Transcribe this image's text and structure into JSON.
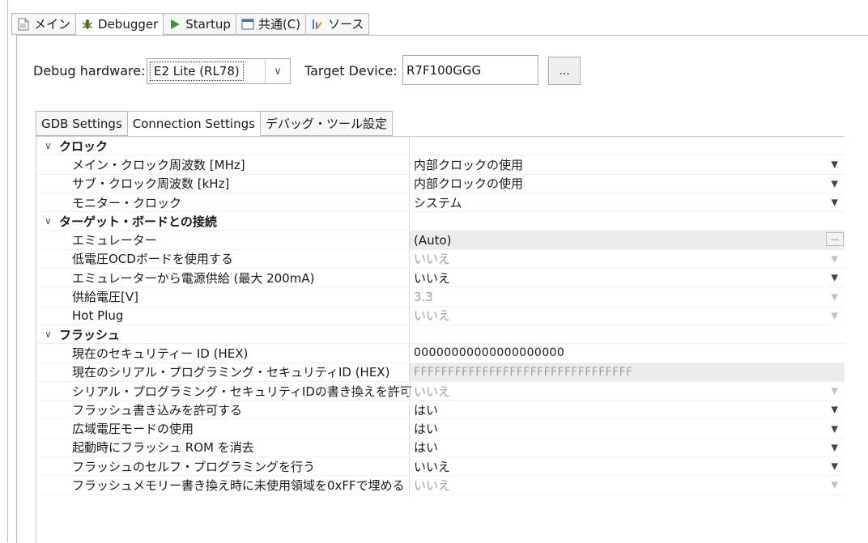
{
  "tabs": [
    {
      "label": "メイン",
      "icon": "document-icon"
    },
    {
      "label": "Debugger",
      "icon": "debugger-bug-icon"
    },
    {
      "label": "Startup",
      "icon": "play-icon"
    },
    {
      "label": "共通(C)",
      "icon": "common-window-icon"
    },
    {
      "label": "ソース",
      "icon": "source-lookup-icon"
    }
  ],
  "debug_hardware": {
    "label": "Debug hardware:",
    "value": "E2 Lite (RL78)"
  },
  "target_device": {
    "label": "Target Device:",
    "value": "R7F100GGG",
    "browse_label": "..."
  },
  "subtabs": [
    "GDB Settings",
    "Connection Settings",
    "デバッグ・ツール設定"
  ],
  "rows": [
    {
      "type": "category",
      "name": "クロック"
    },
    {
      "type": "prop",
      "name": "メイン・クロック周波数 [MHz]",
      "value": "内部クロックの使用",
      "control": "dropdown"
    },
    {
      "type": "prop",
      "name": "サブ・クロック周波数 [kHz]",
      "value": "内部クロックの使用",
      "control": "dropdown"
    },
    {
      "type": "prop",
      "name": "モニター・クロック",
      "value": "システム",
      "control": "dropdown"
    },
    {
      "type": "category",
      "name": "ターゲット・ボードとの接続"
    },
    {
      "type": "prop",
      "name": "エミュレーター",
      "value": "(Auto)",
      "control": "button",
      "shaded": true,
      "button_label": "..."
    },
    {
      "type": "prop",
      "name": "低電圧OCDボードを使用する",
      "value": "いいえ",
      "control": "dropdown",
      "disabled": true
    },
    {
      "type": "prop",
      "name": "エミュレーターから電源供給 (最大 200mA)",
      "value": "いいえ",
      "control": "dropdown"
    },
    {
      "type": "prop",
      "name": "供給電圧[V]",
      "value": "3.3",
      "control": "dropdown",
      "disabled": true
    },
    {
      "type": "prop",
      "name": "Hot Plug",
      "value": "いいえ",
      "control": "dropdown",
      "disabled": true
    },
    {
      "type": "category",
      "name": "フラッシュ"
    },
    {
      "type": "prop",
      "name": "現在のセキュリティー ID (HEX)",
      "value": "00000000000000000000",
      "control": "text",
      "mono": true
    },
    {
      "type": "prop",
      "name": "現在のシリアル・プログラミング・セキュリティID (HEX)",
      "value": "FFFFFFFFFFFFFFFFFFFFFFFFFFFFFFFF",
      "control": "text",
      "mono": true,
      "disabled": true,
      "shaded": true
    },
    {
      "type": "prop",
      "name": "シリアル・プログラミング・セキュリティIDの書き換えを許可",
      "value": "いいえ",
      "control": "dropdown",
      "disabled": true
    },
    {
      "type": "prop",
      "name": "フラッシュ書き込みを許可する",
      "value": "はい",
      "control": "dropdown"
    },
    {
      "type": "prop",
      "name": "広域電圧モードの使用",
      "value": "はい",
      "control": "dropdown"
    },
    {
      "type": "prop",
      "name": "起動時にフラッシュ ROM を消去",
      "value": "はい",
      "control": "dropdown"
    },
    {
      "type": "prop",
      "name": "フラッシュのセルフ・プログラミングを行う",
      "value": "いいえ",
      "control": "dropdown"
    },
    {
      "type": "prop",
      "name": "フラッシュメモリー書き換え時に未使用領域を0xFFで埋める",
      "value": "いいえ",
      "control": "dropdown",
      "disabled": true
    }
  ]
}
